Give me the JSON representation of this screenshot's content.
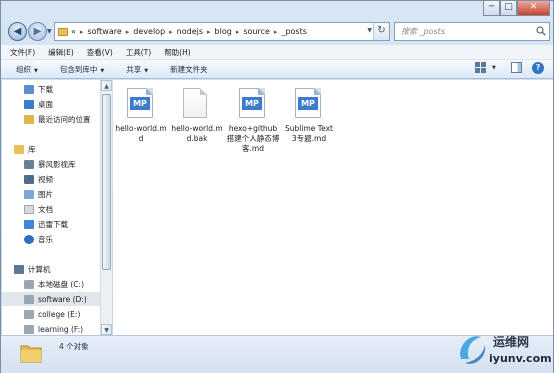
{
  "window": {
    "caption_buttons": {
      "minimize": "─",
      "maximize": "□",
      "close": "✕"
    }
  },
  "address": {
    "overflow": "«",
    "crumbs": [
      "software",
      "develop",
      "nodejs",
      "blog",
      "source",
      "_posts"
    ],
    "search_placeholder": "搜索 _posts"
  },
  "menu": [
    "文件(F)",
    "编辑(E)",
    "查看(V)",
    "工具(T)",
    "帮助(H)"
  ],
  "commands": {
    "organize": "组织",
    "include_library": "包含到库中",
    "share": "共享",
    "new_folder": "新建文件夹"
  },
  "navpane": {
    "favorites": [
      {
        "label": "下载",
        "icon": "download-folder-icon"
      },
      {
        "label": "桌面",
        "icon": "desktop-icon"
      },
      {
        "label": "最近访问的位置",
        "icon": "recent-places-icon"
      }
    ],
    "library_title": "库",
    "libraries": [
      {
        "label": "暴风影视库",
        "icon": "video-library-icon"
      },
      {
        "label": "视频",
        "icon": "video-icon"
      },
      {
        "label": "图片",
        "icon": "pictures-icon"
      },
      {
        "label": "文档",
        "icon": "documents-icon"
      },
      {
        "label": "迅雷下载",
        "icon": "download-icon"
      },
      {
        "label": "音乐",
        "icon": "music-icon"
      }
    ],
    "computer_title": "计算机",
    "drives": [
      {
        "label": "本地磁盘 (C:)",
        "icon": "drive-icon",
        "selected": false
      },
      {
        "label": "software (D:)",
        "icon": "drive-icon",
        "selected": true
      },
      {
        "label": "college (E:)",
        "icon": "drive-icon",
        "selected": false
      },
      {
        "label": "learning (F:)",
        "icon": "drive-icon",
        "selected": false
      }
    ]
  },
  "files": [
    {
      "name": "hello-world.md",
      "icon": "markdown-file-icon",
      "badge": "MP"
    },
    {
      "name": "hello-world.md.bak",
      "icon": "blank-file-icon",
      "badge": ""
    },
    {
      "name": "hexo+github搭建个人静态博客.md",
      "icon": "markdown-file-icon",
      "badge": "MP"
    },
    {
      "name": "Sublime Text 3专题.md",
      "icon": "markdown-file-icon",
      "badge": "MP"
    }
  ],
  "status": {
    "text": "4 个对象"
  },
  "watermark": {
    "cn": "运维网",
    "en": "iyunv.com"
  }
}
